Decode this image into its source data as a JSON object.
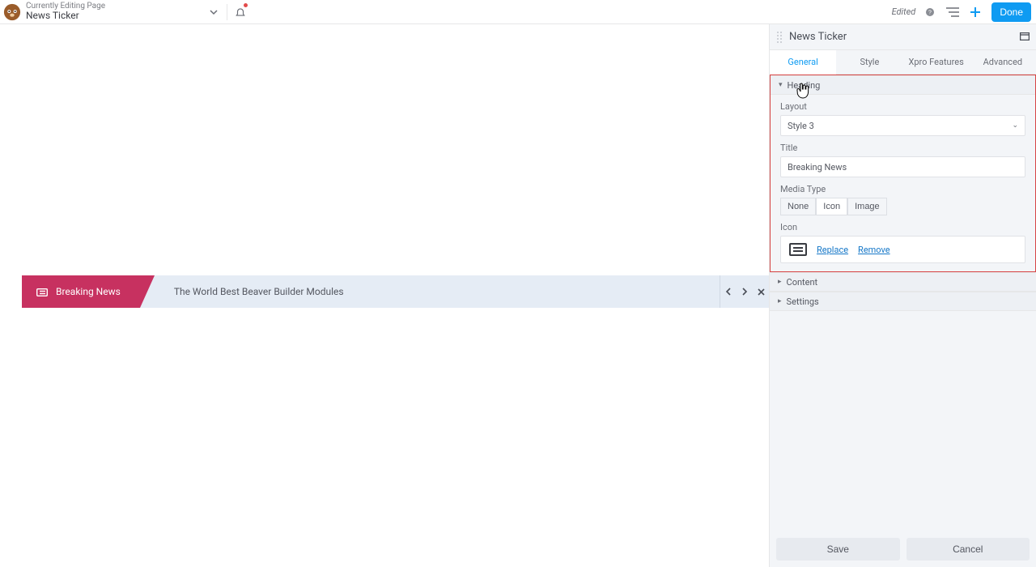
{
  "topbar": {
    "meta_label": "Currently Editing Page",
    "page_title": "News Ticker",
    "edited_label": "Edited",
    "done_label": "Done"
  },
  "panel": {
    "title": "News Ticker",
    "tabs": {
      "general": "General",
      "style": "Style",
      "xpro": "Xpro Features",
      "advanced": "Advanced"
    },
    "sections": {
      "heading": "Heading",
      "content": "Content",
      "settings": "Settings"
    },
    "fields": {
      "layout_label": "Layout",
      "layout_value": "Style 3",
      "title_label": "Title",
      "title_value": "Breaking News",
      "media_type_label": "Media Type",
      "media_options": {
        "none": "None",
        "icon": "Icon",
        "image": "Image"
      },
      "icon_label": "Icon",
      "replace": "Replace",
      "remove": "Remove"
    },
    "footer": {
      "save": "Save",
      "cancel": "Cancel"
    }
  },
  "ticker": {
    "badge": "Breaking News",
    "text": "The World Best Beaver Builder Modules"
  }
}
